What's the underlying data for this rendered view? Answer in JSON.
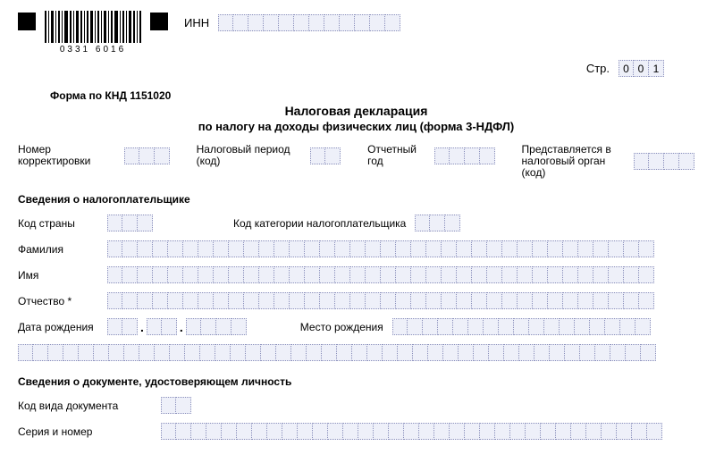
{
  "barcode_number": "0331  6016",
  "inn_label": "ИНН",
  "str_label": "Стр.",
  "page_digits": [
    "0",
    "0",
    "1"
  ],
  "knd": "Форма по КНД 1151020",
  "title": "Налоговая декларация",
  "subtitle": "по налогу на доходы физических лиц (форма 3-НДФЛ)",
  "row1": {
    "correction": "Номер корректировки",
    "tax_period": "Налоговый период (код)",
    "report_year": "Отчетный год",
    "submitted_to": "Представляется в налоговый орган (код)"
  },
  "section_taxpayer": "Сведения о налогоплательщике",
  "taxpayer": {
    "country_code": "Код страны",
    "category_code": "Код категории налогоплательщика",
    "surname": "Фамилия",
    "name": "Имя",
    "patronymic": "Отчество *",
    "dob": "Дата рождения",
    "birthplace": "Место рождения"
  },
  "section_doc": "Сведения о документе, удостоверяющем личность",
  "doc": {
    "type_code": "Код вида документа",
    "series_number": "Серия и номер"
  }
}
